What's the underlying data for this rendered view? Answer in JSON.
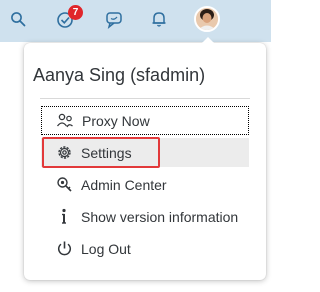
{
  "topbar": {
    "icons": [
      "search-icon",
      "todo-check-icon",
      "feedback-chat-icon",
      "bell-icon",
      "user-avatar"
    ],
    "notification_count": "7",
    "badge_color": "#e0262b",
    "background_color": "#cfe1ee"
  },
  "menu": {
    "user_name": "Aanya Sing (sfadmin)",
    "items": [
      {
        "label": "Proxy Now",
        "icon": "proxy-users-icon"
      },
      {
        "label": "Settings",
        "icon": "gear-icon"
      },
      {
        "label": "Admin Center",
        "icon": "admin-key-icon"
      },
      {
        "label": "Show version information",
        "icon": "info-icon"
      },
      {
        "label": "Log Out",
        "icon": "power-icon"
      }
    ],
    "highlight_color": "#e2393a"
  }
}
